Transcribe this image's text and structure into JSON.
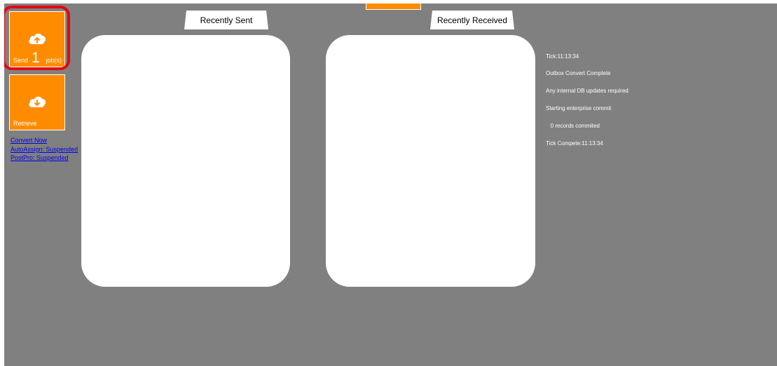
{
  "tiles": {
    "send": {
      "label": "Send",
      "count": "1",
      "unit": "job(s)",
      "icon": "cloud-upload-icon"
    },
    "retrieve": {
      "label": "Retrieve",
      "icon": "cloud-download-icon"
    }
  },
  "links": [
    "Convert Now",
    "AutoAssign: Suspended",
    "PostPro: Suspended"
  ],
  "panels": {
    "sent_title": "Recently Sent",
    "received_title": "Recently Received"
  },
  "log": [
    "Tick:11:13:34",
    "Outbox Convert Complete",
    "Any internal DB updates required",
    "Starting enterprise commit",
    "   0 records commited",
    "Tick Compete:11:13:34"
  ],
  "colors": {
    "background": "#808080",
    "accent": "#ff8c00",
    "highlight": "#e30613",
    "link": "#0000ee"
  }
}
